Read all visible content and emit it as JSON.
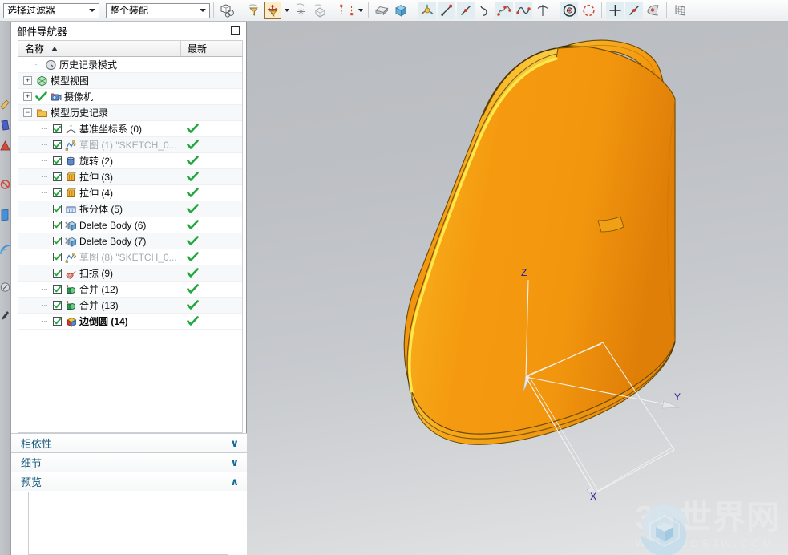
{
  "toolbar": {
    "filter_combo": {
      "value": "选择过滤器",
      "options": [
        "选择过滤器"
      ]
    },
    "scope_combo": {
      "value": "整个装配",
      "options": [
        "整个装配"
      ]
    },
    "buttons": [
      {
        "name": "assembly-select-icon",
        "tip": "装配选择"
      },
      {
        "name": "filter-funnel-icon",
        "tip": "过滤器"
      },
      {
        "name": "move-filter-icon",
        "tip": "移动过滤器",
        "selected": true
      },
      {
        "name": "snap-point-icon",
        "tip": "捕捉点"
      },
      {
        "name": "measure-icon",
        "tip": "测量"
      },
      {
        "name": "rectangle-select-icon",
        "tip": "矩形选择"
      },
      {
        "name": "shaded-view-icon",
        "tip": "着色显示"
      },
      {
        "name": "solid-body-icon",
        "tip": "实体"
      },
      {
        "name": "datum-csys-icon",
        "tip": "基准坐标系"
      },
      {
        "name": "line-icon",
        "tip": "直线"
      },
      {
        "name": "line-alt-icon",
        "tip": "直线（备用）"
      },
      {
        "name": "spline-curve-icon",
        "tip": "样条曲线"
      },
      {
        "name": "studio-spline-icon",
        "tip": "艺术样条"
      },
      {
        "name": "wave-curve-icon",
        "tip": "曲线"
      },
      {
        "name": "helix-icon",
        "tip": "螺旋线"
      },
      {
        "name": "circle-center-icon",
        "tip": "圆"
      },
      {
        "name": "arc-icon",
        "tip": "圆弧"
      },
      {
        "name": "cross-point-icon",
        "tip": "点"
      },
      {
        "name": "line-point-icon",
        "tip": "点在线上"
      },
      {
        "name": "sheet-body-icon",
        "tip": "片体"
      },
      {
        "name": "grid-surface-icon",
        "tip": "网格曲面"
      }
    ]
  },
  "navigator": {
    "title": "部件导航器",
    "maximize_icon": "maximize-icon",
    "columns": [
      "名称",
      "最新"
    ],
    "sort": "ascending",
    "rows": [
      {
        "indent": 1,
        "expander": "",
        "checkbox": false,
        "icon": "clock-icon",
        "label": "历史记录模式",
        "gray": false,
        "bold": false,
        "status": ""
      },
      {
        "indent": 0,
        "expander": "+",
        "checkbox": false,
        "icon": "model-view-icon",
        "label": "模型视图",
        "gray": false,
        "bold": false,
        "status": ""
      },
      {
        "indent": 0,
        "expander": "+",
        "checkbox": false,
        "icon": "camera-icon",
        "label": "摄像机",
        "gray": false,
        "bold": false,
        "status": "",
        "precheck": true
      },
      {
        "indent": 0,
        "expander": "−",
        "checkbox": false,
        "icon": "folder-icon",
        "label": "模型历史记录",
        "gray": false,
        "bold": false,
        "status": ""
      },
      {
        "indent": 2,
        "expander": "",
        "checkbox": true,
        "icon": "datum-csys-icon",
        "label": "基准坐标系 (0)",
        "gray": false,
        "bold": false,
        "status": "check"
      },
      {
        "indent": 2,
        "expander": "",
        "checkbox": true,
        "icon": "sketch-icon",
        "label": "草图 (1) \"SKETCH_0...",
        "gray": true,
        "bold": false,
        "status": "check"
      },
      {
        "indent": 2,
        "expander": "",
        "checkbox": true,
        "icon": "revolve-icon",
        "label": "旋转 (2)",
        "gray": false,
        "bold": false,
        "status": "check"
      },
      {
        "indent": 2,
        "expander": "",
        "checkbox": true,
        "icon": "extrude-icon",
        "label": "拉伸 (3)",
        "gray": false,
        "bold": false,
        "status": "check"
      },
      {
        "indent": 2,
        "expander": "",
        "checkbox": true,
        "icon": "extrude-icon",
        "label": "拉伸 (4)",
        "gray": false,
        "bold": false,
        "status": "check"
      },
      {
        "indent": 2,
        "expander": "",
        "checkbox": true,
        "icon": "split-body-icon",
        "label": "拆分体 (5)",
        "gray": false,
        "bold": false,
        "status": "check"
      },
      {
        "indent": 2,
        "expander": "",
        "checkbox": true,
        "icon": "delete-body-icon",
        "label": "Delete Body (6)",
        "gray": false,
        "bold": false,
        "status": "check"
      },
      {
        "indent": 2,
        "expander": "",
        "checkbox": true,
        "icon": "delete-body-icon",
        "label": "Delete Body (7)",
        "gray": false,
        "bold": false,
        "status": "check"
      },
      {
        "indent": 2,
        "expander": "",
        "checkbox": true,
        "icon": "sketch-icon",
        "label": "草图 (8) \"SKETCH_0...",
        "gray": true,
        "bold": false,
        "status": "check"
      },
      {
        "indent": 2,
        "expander": "",
        "checkbox": true,
        "icon": "sweep-icon",
        "label": "扫掠 (9)",
        "gray": false,
        "bold": false,
        "status": "check"
      },
      {
        "indent": 2,
        "expander": "",
        "checkbox": true,
        "icon": "unite-icon",
        "label": "合并 (12)",
        "gray": false,
        "bold": false,
        "status": "check"
      },
      {
        "indent": 2,
        "expander": "",
        "checkbox": true,
        "icon": "unite-icon",
        "label": "合并 (13)",
        "gray": false,
        "bold": false,
        "status": "check"
      },
      {
        "indent": 2,
        "expander": "",
        "checkbox": true,
        "icon": "edge-blend-icon",
        "label": "边倒圆 (14)",
        "gray": false,
        "bold": true,
        "status": "check"
      }
    ],
    "scroll_prev": "‹",
    "scroll_next": "›",
    "sections": [
      {
        "label": "相依性",
        "state": "collapsed",
        "chevron": "∨"
      },
      {
        "label": "细节",
        "state": "collapsed",
        "chevron": "∨"
      },
      {
        "label": "预览",
        "state": "expanded",
        "chevron": "∧"
      }
    ]
  },
  "viewport": {
    "model_name": "orange-pitcher-model",
    "model_color": "#F59A10",
    "highlight_color": "#FFE033",
    "background_top": "#b9bcc0",
    "background_bottom": "#e4e6e8",
    "axes": [
      {
        "label": "Z",
        "color": "#2020A0"
      },
      {
        "label": "Y",
        "color": "#2020A0"
      },
      {
        "label": "X",
        "color": "#2020A0"
      }
    ]
  },
  "watermark": {
    "brand": "3D世界网",
    "url": "WWW.3DSJW.COM",
    "logo_icon": "cube-hexagon-logo",
    "color": "#8fc8e8"
  }
}
